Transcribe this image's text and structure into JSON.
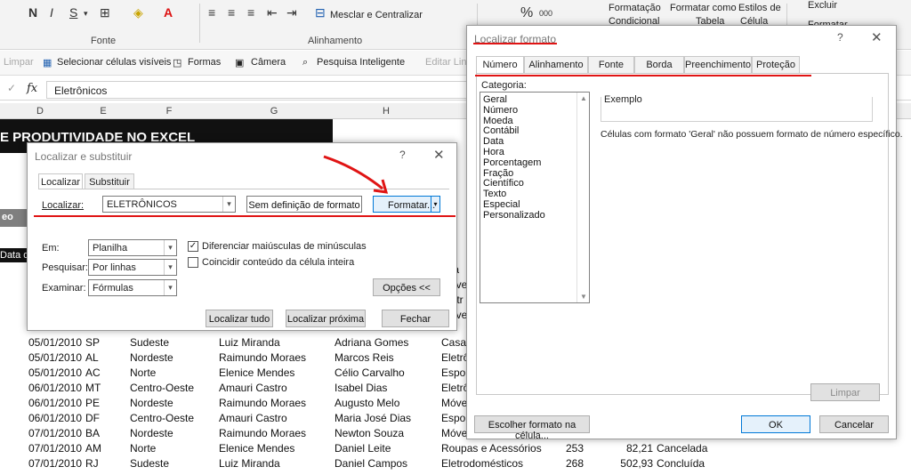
{
  "ribbon": {
    "bold": "N",
    "italic": "I",
    "underline": "S",
    "fonte_label": "Fonte",
    "alinhamento_label": "Alinhamento",
    "merge_label": "Mesclar e Centralizar",
    "percent": "%",
    "decimals": "000",
    "cond_format_1": "Formatação",
    "cond_format_2": "Condicional",
    "format_table_1": "Formatar como",
    "format_table_2": "Tabela",
    "cell_styles_1": "Estilos de",
    "cell_styles_2": "Célula",
    "delete": "Excluir",
    "format": "Formatar"
  },
  "qbar": {
    "limpar": "Limpar",
    "select_visible": "Selecionar células visíveis",
    "formas": "Formas",
    "camera": "Câmera",
    "smart_search": "Pesquisa Inteligente",
    "edit_link": "Editar Lin"
  },
  "formula_bar": {
    "fx": "fx",
    "value": "Eletrônicos"
  },
  "columns": [
    "D",
    "E",
    "F",
    "G",
    "H"
  ],
  "sheet": {
    "banner": "E PRODUTIVIDADE NO EXCEL",
    "grey_button": "eo",
    "header_cell": "Data d",
    "rows": [
      {
        "date": "05/01/2010",
        "uf": "SP",
        "region": "Sudeste",
        "manager": "Luiz Miranda",
        "seller": "Adriana Gomes",
        "cat": "Casa d",
        "qty": "",
        "value": "",
        "status": ""
      },
      {
        "date": "05/01/2010",
        "uf": "AL",
        "region": "Nordeste",
        "manager": "Raimundo Moraes",
        "seller": "Marcos Reis",
        "cat": "Eletrô",
        "qty": "",
        "value": "",
        "status": ""
      },
      {
        "date": "05/01/2010",
        "uf": "AC",
        "region": "Norte",
        "manager": "Elenice Mendes",
        "seller": "Célio Carvalho",
        "cat": "Espor",
        "qty": "",
        "value": "",
        "status": ""
      },
      {
        "date": "06/01/2010",
        "uf": "MT",
        "region": "Centro-Oeste",
        "manager": "Amauri Castro",
        "seller": "Isabel Dias",
        "cat": "Eletrô",
        "qty": "",
        "value": "",
        "status": ""
      },
      {
        "date": "06/01/2010",
        "uf": "PE",
        "region": "Nordeste",
        "manager": "Raimundo Moraes",
        "seller": "Augusto Melo",
        "cat": "Móve",
        "qty": "",
        "value": "",
        "status": ""
      },
      {
        "date": "06/01/2010",
        "uf": "DF",
        "region": "Centro-Oeste",
        "manager": "Amauri Castro",
        "seller": "Maria José Dias",
        "cat": "Espor",
        "qty": "",
        "value": "",
        "status": ""
      },
      {
        "date": "07/01/2010",
        "uf": "BA",
        "region": "Nordeste",
        "manager": "Raimundo Moraes",
        "seller": "Newton Souza",
        "cat": "Móve",
        "qty": "",
        "value": "",
        "status": ""
      },
      {
        "date": "07/01/2010",
        "uf": "AM",
        "region": "Norte",
        "manager": "Elenice Mendes",
        "seller": "Daniel Leite",
        "cat": "Roupas e Acessórios",
        "qty": "253",
        "value": "82,21",
        "status": "Cancelada"
      },
      {
        "date": "07/01/2010",
        "uf": "RJ",
        "region": "Sudeste",
        "manager": "Luiz Miranda",
        "seller": "Daniel Campos",
        "cat": "Eletrodomésticos",
        "qty": "268",
        "value": "502,93",
        "status": "Concluída"
      }
    ],
    "side_cells": [
      "upa",
      "Móve",
      "Eletr",
      "Móve"
    ]
  },
  "find_dialog": {
    "title": "Localizar e substituir",
    "help": "?",
    "close": "✕",
    "tab_find": "Localizar",
    "tab_replace": "Substituir",
    "find_label": "Localizar:",
    "find_value": "ELETRÔNICOS",
    "no_format": "Sem definição de formato",
    "format_btn": "Formatar...",
    "within_label": "Em:",
    "within_value": "Planilha",
    "search_label": "Pesquisar:",
    "search_value": "Por linhas",
    "lookin_label": "Examinar:",
    "lookin_value": "Fórmulas",
    "match_case": "Diferenciar maiúsculas de minúsculas",
    "match_case_checked": true,
    "match_entire": "Coincidir conteúdo da célula inteira",
    "match_entire_checked": false,
    "options_btn": "Opções <<",
    "find_all": "Localizar tudo",
    "find_next": "Localizar próxima",
    "close_btn": "Fechar"
  },
  "format_dialog": {
    "title": "Localizar formato",
    "help": "?",
    "close": "✕",
    "tabs": [
      "Número",
      "Alinhamento",
      "Fonte",
      "Borda",
      "Preenchimento",
      "Proteção"
    ],
    "category_label": "Categoria:",
    "categories": [
      "Geral",
      "Número",
      "Moeda",
      "Contábil",
      "Data",
      "Hora",
      "Porcentagem",
      "Fração",
      "Científico",
      "Texto",
      "Especial",
      "Personalizado"
    ],
    "sample_label": "Exemplo",
    "description": "Células com formato 'Geral' não possuem formato de número específico.",
    "clear_btn": "Limpar",
    "choose_from_cell": "Escolher formato na célula...",
    "ok": "OK",
    "cancel": "Cancelar"
  },
  "colors": {
    "annotation_red": "#e01414",
    "accent_blue": "#0078d7"
  }
}
